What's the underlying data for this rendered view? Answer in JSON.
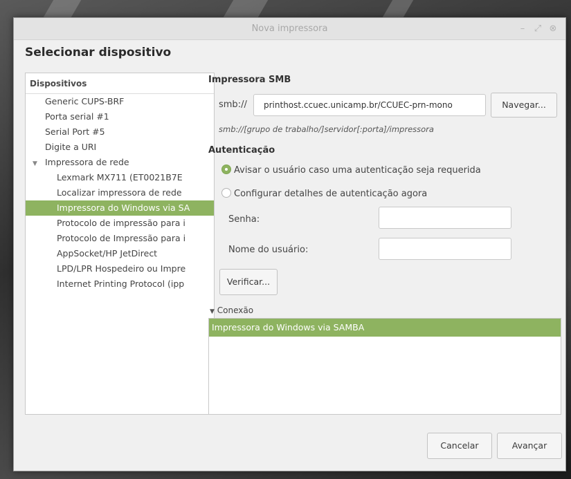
{
  "window": {
    "title": "Nova impressora",
    "heading": "Selecionar dispositivo"
  },
  "devices": {
    "header": "Dispositivos",
    "items": [
      {
        "label": "Generic CUPS-BRF",
        "level": 0
      },
      {
        "label": "Porta serial #1",
        "level": 0
      },
      {
        "label": "Serial Port #5",
        "level": 0
      },
      {
        "label": "Digite a URI",
        "level": 0
      },
      {
        "label": "Impressora de rede",
        "level": 0,
        "expanded": true
      },
      {
        "label": "Lexmark MX711 (ET0021B7E",
        "level": 1
      },
      {
        "label": "Localizar impressora de rede",
        "level": 1
      },
      {
        "label": "Impressora do Windows via SA",
        "level": 1,
        "selected": true
      },
      {
        "label": "Protocolo de impressão para i",
        "level": 1
      },
      {
        "label": "Protocolo de Impressão para i",
        "level": 1
      },
      {
        "label": "AppSocket/HP JetDirect",
        "level": 1
      },
      {
        "label": "LPD/LPR Hospedeiro ou Impre",
        "level": 1
      },
      {
        "label": "Internet Printing Protocol (ipp",
        "level": 1
      }
    ]
  },
  "smb": {
    "section_title": "Impressora SMB",
    "prefix": "smb://",
    "uri_value": "printhost.ccuec.unicamp.br/CCUEC-prn-mono",
    "browse_label": "Navegar...",
    "hint": "smb://[grupo de trabalho/]servidor[:porta]/impressora"
  },
  "auth": {
    "section_title": "Autenticação",
    "option_prompt": "Avisar o usuário caso uma autenticação seja requerida",
    "option_configure": "Configurar detalhes de autenticação agora",
    "password_label": "Senha:",
    "password_value": "",
    "username_label": "Nome do usuário:",
    "username_value": "",
    "verify_label": "Verificar..."
  },
  "connection": {
    "toggle_label": "Conexão",
    "items": [
      "Impressora do Windows via SAMBA"
    ]
  },
  "footer": {
    "cancel_label": "Cancelar",
    "forward_label": "Avançar"
  },
  "colors": {
    "accent": "#8eb360",
    "window_bg": "#f0f0f0",
    "titlebar_bg": "#e3e3e3"
  }
}
